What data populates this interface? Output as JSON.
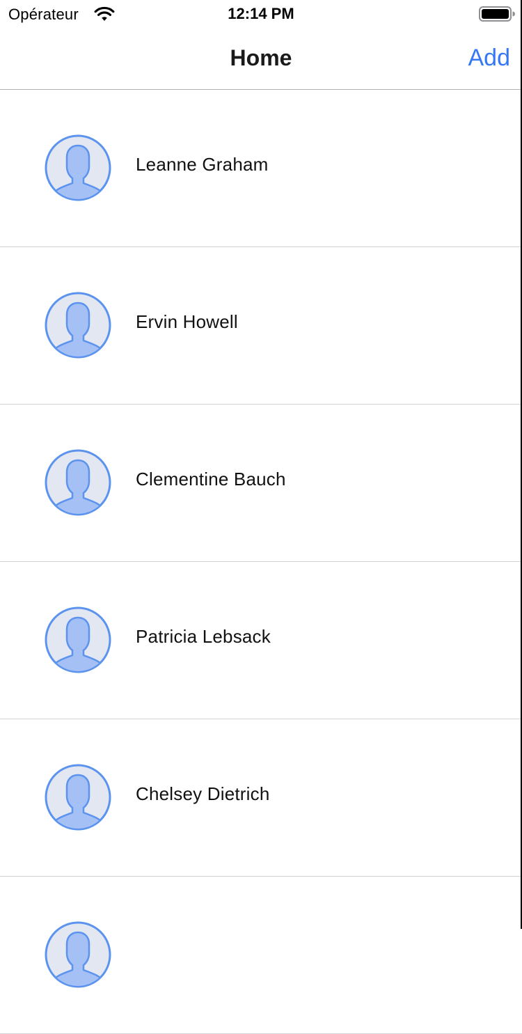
{
  "status_bar": {
    "carrier": "Opérateur",
    "time": "12:14 PM",
    "wifi_icon": "wifi-icon",
    "battery_icon": "battery-icon"
  },
  "nav": {
    "title": "Home",
    "add_label": "Add",
    "accent_color": "#3478f6"
  },
  "contacts": [
    {
      "name": "Leanne Graham",
      "avatar_icon": "user-avatar-icon"
    },
    {
      "name": "Ervin Howell",
      "avatar_icon": "user-avatar-icon"
    },
    {
      "name": "Clementine Bauch",
      "avatar_icon": "user-avatar-icon"
    },
    {
      "name": "Patricia Lebsack",
      "avatar_icon": "user-avatar-icon"
    },
    {
      "name": "Chelsey Dietrich",
      "avatar_icon": "user-avatar-icon"
    },
    {
      "name": "",
      "avatar_icon": "user-avatar-icon"
    }
  ],
  "colors": {
    "avatar_stroke": "#5b93ef",
    "avatar_fill": "#a4c0f4",
    "avatar_bg": "#e2e7f2",
    "separator": "#d3d3d7"
  }
}
